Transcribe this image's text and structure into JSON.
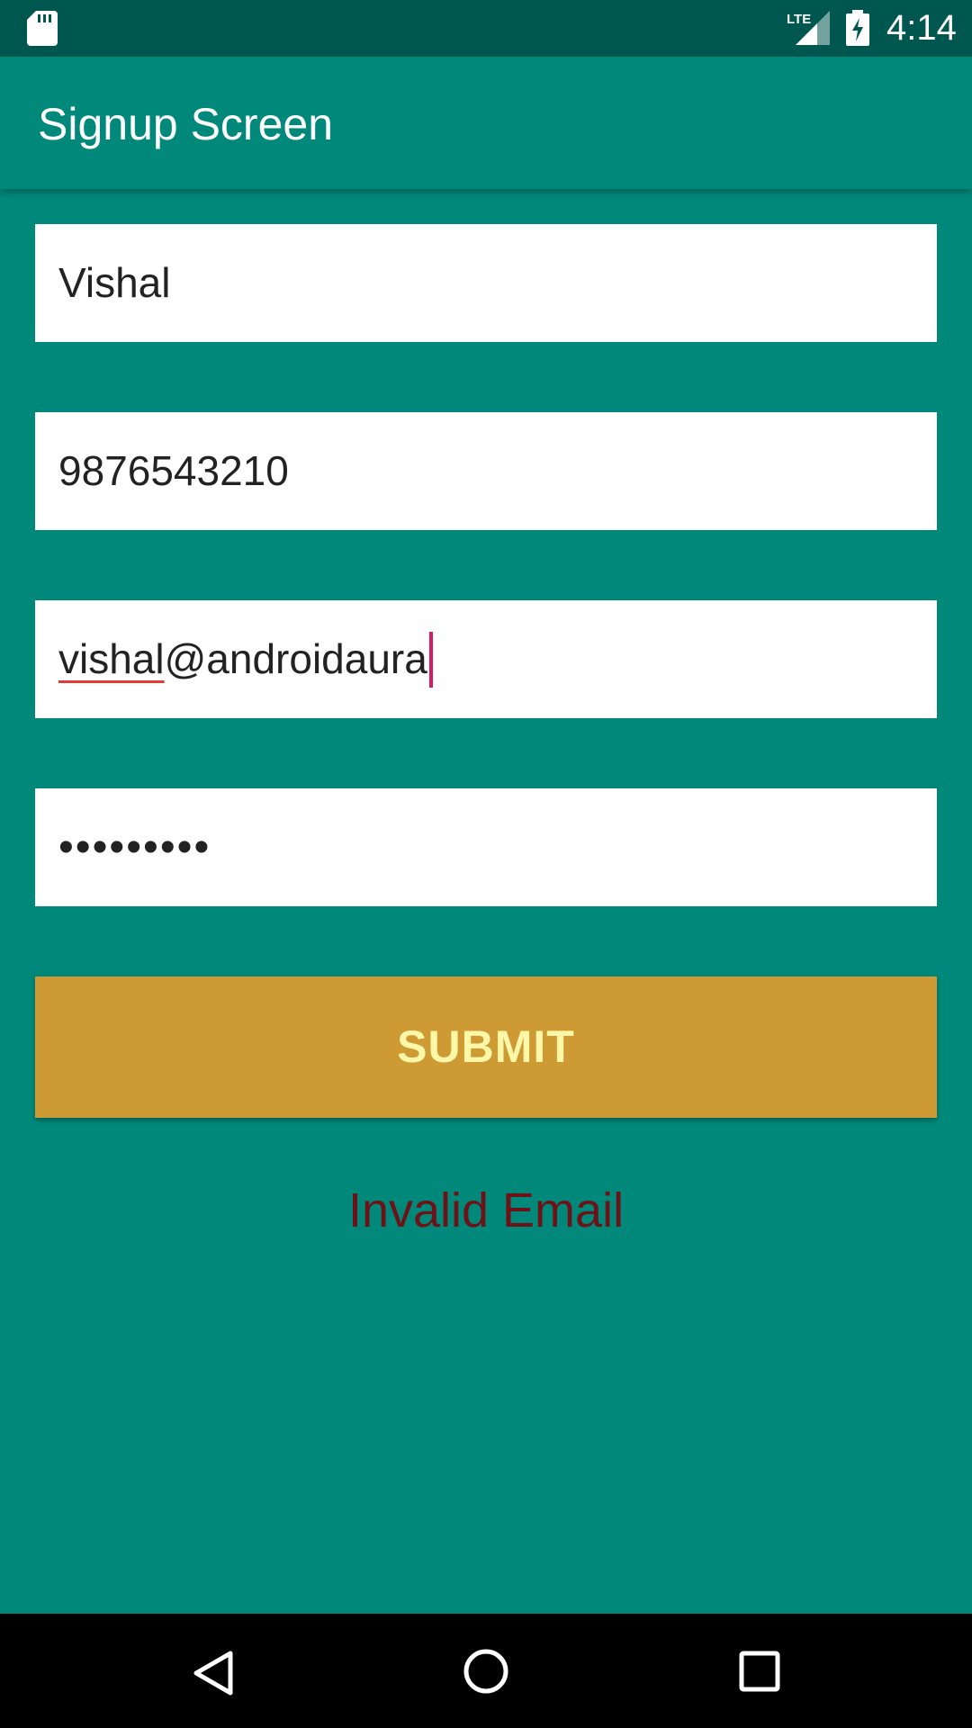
{
  "status_bar": {
    "time": "4:14",
    "network": "LTE",
    "icons": [
      "sd-card-icon",
      "lte-signal-icon",
      "battery-charging-icon"
    ]
  },
  "app_bar": {
    "title": "Signup Screen"
  },
  "form": {
    "name_value": "Vishal",
    "phone_value": "9876543210",
    "email_user": "vishal",
    "email_rest": "@androidaura",
    "password_value": "•••••••••"
  },
  "submit": {
    "label": "SUBMIT"
  },
  "message": {
    "text": "Invalid Email"
  },
  "navigation": {
    "icons": [
      "back-icon",
      "home-icon",
      "recents-icon"
    ]
  },
  "colors": {
    "primary": "#00887a",
    "primary_dark": "#00574f",
    "button": "#cd9a33",
    "button_text": "#fff7a8",
    "error_text": "#6d1318",
    "cursor": "#d81b60"
  }
}
